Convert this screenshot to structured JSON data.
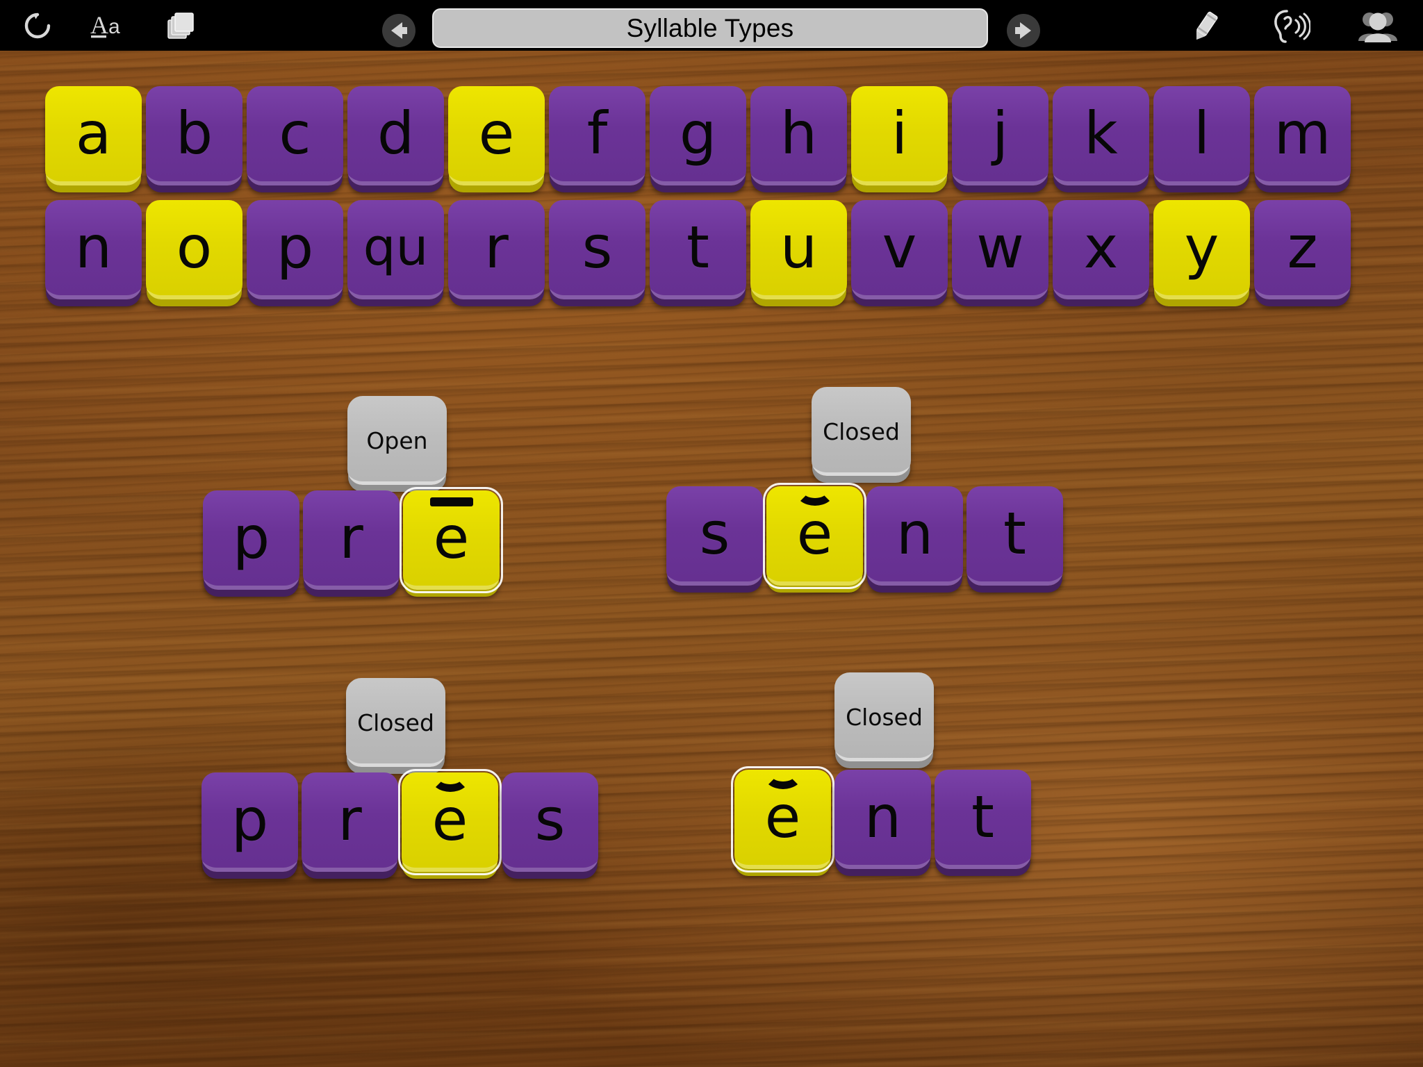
{
  "app": {
    "title": "Syllable Types",
    "background": "wood-desk"
  },
  "toolbar": {
    "left_icons": [
      {
        "name": "refresh-icon",
        "glyph": "↻",
        "label": "Refresh"
      },
      {
        "name": "font-size-icon",
        "glyph": "Aa",
        "label": "Aa"
      },
      {
        "name": "copy-stack-icon",
        "glyph": "⧉",
        "label": "Pages"
      }
    ],
    "nav_back": {
      "name": "back-arrow-icon",
      "label": "Back"
    },
    "nav_forward": {
      "name": "forward-arrow-icon",
      "label": "Forward"
    },
    "title": "Syllable Types",
    "right_icons": [
      {
        "name": "crayon-icon",
        "label": "Draw"
      },
      {
        "name": "ear-listen-icon",
        "label": "Listen"
      },
      {
        "name": "users-icon",
        "label": "Users"
      }
    ]
  },
  "colors": {
    "vowel": "#E2D900",
    "consonant": "#6B3397",
    "label": "#BCBCBC",
    "toolbar": "#000000",
    "title_pill": "#C2C2C2",
    "wood": "#8A4F1C",
    "glyph": "#070707"
  },
  "alphabet": {
    "rows": [
      [
        {
          "letter": "a",
          "type": "vowel"
        },
        {
          "letter": "b",
          "type": "consonant"
        },
        {
          "letter": "c",
          "type": "consonant"
        },
        {
          "letter": "d",
          "type": "consonant"
        },
        {
          "letter": "e",
          "type": "vowel"
        },
        {
          "letter": "f",
          "type": "consonant"
        },
        {
          "letter": "g",
          "type": "consonant"
        },
        {
          "letter": "h",
          "type": "consonant"
        },
        {
          "letter": "i",
          "type": "vowel"
        },
        {
          "letter": "j",
          "type": "consonant"
        },
        {
          "letter": "k",
          "type": "consonant"
        },
        {
          "letter": "l",
          "type": "consonant"
        },
        {
          "letter": "m",
          "type": "consonant"
        }
      ],
      [
        {
          "letter": "n",
          "type": "consonant"
        },
        {
          "letter": "o",
          "type": "vowel"
        },
        {
          "letter": "p",
          "type": "consonant"
        },
        {
          "letter": "qu",
          "type": "consonant"
        },
        {
          "letter": "r",
          "type": "consonant"
        },
        {
          "letter": "s",
          "type": "consonant"
        },
        {
          "letter": "t",
          "type": "consonant"
        },
        {
          "letter": "u",
          "type": "vowel"
        },
        {
          "letter": "v",
          "type": "consonant"
        },
        {
          "letter": "w",
          "type": "consonant"
        },
        {
          "letter": "x",
          "type": "consonant"
        },
        {
          "letter": "y",
          "type": "vowel"
        },
        {
          "letter": "z",
          "type": "consonant"
        }
      ]
    ]
  },
  "words": [
    {
      "id": "word-pre-open",
      "syllable_label": "Open",
      "tiles": [
        {
          "letter": "p",
          "type": "consonant",
          "mark": "none",
          "selected": false
        },
        {
          "letter": "r",
          "type": "consonant",
          "mark": "none",
          "selected": false
        },
        {
          "letter": "e",
          "type": "vowel",
          "mark": "macron",
          "selected": true
        }
      ]
    },
    {
      "id": "word-sent-closed",
      "syllable_label": "Closed",
      "tiles": [
        {
          "letter": "s",
          "type": "consonant",
          "mark": "none",
          "selected": false
        },
        {
          "letter": "e",
          "type": "vowel",
          "mark": "breve",
          "selected": true
        },
        {
          "letter": "n",
          "type": "consonant",
          "mark": "none",
          "selected": false
        },
        {
          "letter": "t",
          "type": "consonant",
          "mark": "none",
          "selected": false
        }
      ]
    },
    {
      "id": "word-pres-closed",
      "syllable_label": "Closed",
      "tiles": [
        {
          "letter": "p",
          "type": "consonant",
          "mark": "none",
          "selected": false
        },
        {
          "letter": "r",
          "type": "consonant",
          "mark": "none",
          "selected": false
        },
        {
          "letter": "e",
          "type": "vowel",
          "mark": "breve",
          "selected": true
        },
        {
          "letter": "s",
          "type": "consonant",
          "mark": "none",
          "selected": false
        }
      ]
    },
    {
      "id": "word-ent-closed",
      "syllable_label": "Closed",
      "tiles": [
        {
          "letter": "e",
          "type": "vowel",
          "mark": "breve",
          "selected": true
        },
        {
          "letter": "n",
          "type": "consonant",
          "mark": "none",
          "selected": false
        },
        {
          "letter": "t",
          "type": "consonant",
          "mark": "none",
          "selected": false
        }
      ]
    }
  ]
}
